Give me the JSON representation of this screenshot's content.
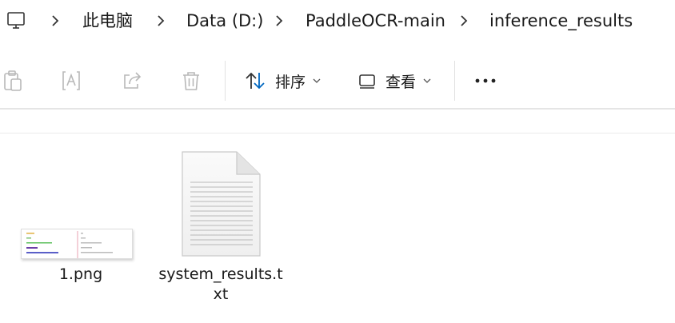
{
  "breadcrumb": {
    "items": [
      "此电脑",
      "Data (D:)",
      "PaddleOCR-main",
      "inference_results"
    ]
  },
  "toolbar": {
    "sort_label": "排序",
    "view_label": "查看",
    "more_label": "•••"
  },
  "files": [
    {
      "name": "1.png",
      "type": "image"
    },
    {
      "name_line1": "system_results.t",
      "name_line2": "xt",
      "type": "text"
    }
  ],
  "colors": {
    "accent": "#0067c0",
    "disabled_icon": "#b8b8b8",
    "divider": "#e5e5e5"
  },
  "icons": {
    "computer": "computer-icon",
    "separator": "chevron-right-icon",
    "copy": "copy-icon",
    "rename": "rename-icon",
    "share": "share-icon",
    "delete": "trash-icon",
    "sort": "sort-icon",
    "view": "view-icon",
    "more": "more-icon"
  }
}
